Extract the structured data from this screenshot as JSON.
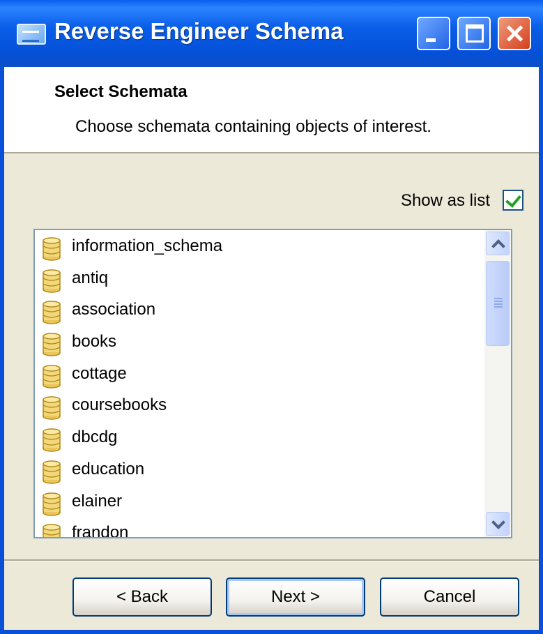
{
  "window": {
    "title": "Reverse Engineer Schema",
    "icon": "app-window-icon",
    "controls": [
      "minimize-icon",
      "maximize-icon",
      "close-icon"
    ]
  },
  "header": {
    "title": "Select Schemata",
    "subtitle": "Choose schemata containing objects of interest."
  },
  "options": {
    "show_as_list_label": "Show as list",
    "show_as_list_checked": true
  },
  "schemata": {
    "item_icon": "database-icon",
    "items": [
      {
        "label": "information_schema"
      },
      {
        "label": "antiq"
      },
      {
        "label": "association"
      },
      {
        "label": "books"
      },
      {
        "label": "cottage"
      },
      {
        "label": "coursebooks"
      },
      {
        "label": "dbcdg"
      },
      {
        "label": "education"
      },
      {
        "label": "elainer"
      },
      {
        "label": "frandon"
      }
    ]
  },
  "buttons": {
    "back": "< Back",
    "next": "Next >",
    "cancel": "Cancel"
  },
  "colors": {
    "titlebar": "#0a5ee8",
    "dialog_bg": "#ece9d8",
    "check_mark": "#21a121",
    "close_button": "#d2401c"
  }
}
